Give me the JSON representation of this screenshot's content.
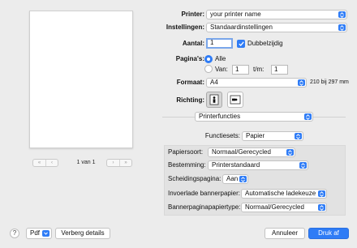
{
  "preview": {
    "page_counter": "1 van 1",
    "nav_first": "«",
    "nav_prev": "‹",
    "nav_next": "›",
    "nav_last": "»"
  },
  "printer": {
    "label": "Printer:",
    "value": "your printer name"
  },
  "presets": {
    "label": "Instellingen:",
    "value": "Standaardinstellingen"
  },
  "copies": {
    "label": "Aantal:",
    "value": "1",
    "two_sided_label": "Dubbelzijdig",
    "two_sided_checked": true
  },
  "pages": {
    "label": "Pagina's:",
    "all_label": "Alle",
    "all_selected": true,
    "range_label": "Van:",
    "from_value": "1",
    "to_label": "t/m:",
    "to_value": "1"
  },
  "paper_size": {
    "label": "Formaat:",
    "value": "A4",
    "dimensions": "210 bij 297 mm"
  },
  "orientation": {
    "label": "Richting:",
    "selected": "portrait"
  },
  "section_menu": {
    "value": "Printerfuncties"
  },
  "feature_sets": {
    "label": "Functiesets:",
    "value": "Papier"
  },
  "options": [
    {
      "label": "Papiersoort:",
      "value": "Normaal/Gerecycled"
    },
    {
      "label": "Bestemming:",
      "value": "Printerstandaard"
    },
    {
      "label": "Scheidingspagina:",
      "value": "Aan"
    },
    {
      "label": "Invoerlade bannerpapier:",
      "value": "Automatische ladekeuze"
    },
    {
      "label": "Bannerpaginapapiertype:",
      "value": "Normaal/Gerecycled"
    }
  ],
  "footer": {
    "help": "?",
    "pdf_label": "Pdf",
    "hide_details_label": "Verberg details",
    "cancel_label": "Annuleer",
    "print_label": "Druk af"
  },
  "colors": {
    "accent": "#2f7cf6",
    "panel": "#e2e2e2",
    "window": "#ececec"
  }
}
